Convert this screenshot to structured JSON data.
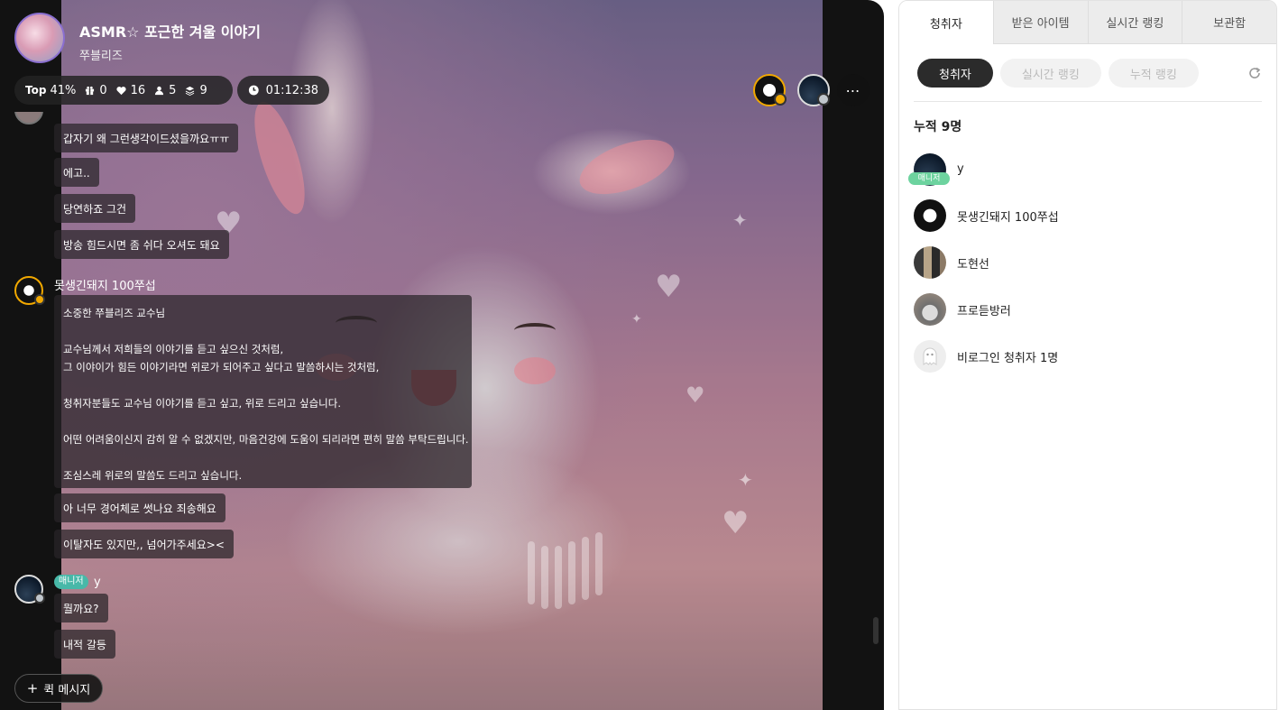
{
  "broadcast": {
    "title": "ASMR☆ 포근한 겨울 이야기",
    "streamer": "쭈블리즈",
    "stats": {
      "top_label": "Top",
      "top_value": "41%",
      "gifts": "0",
      "likes": "16",
      "listeners": "5",
      "cumulative": "9"
    },
    "elapsed": "01:12:38"
  },
  "chat": {
    "messages_top": [
      "갑자기 왜 그런생각이드셨을까요ㅠㅠ",
      "에고..",
      "당연하죠 그건",
      "방송 힘드시면 좀 쉬다 오셔도 돼요"
    ],
    "sender2": {
      "name": "못생긴돼지 100쭈섭",
      "long_message": [
        "소중한 쭈블리즈 교수님",
        "",
        "교수님께서 저희들의 이야기를 듣고 싶으신 것처럼,",
        "그 이야이가 힘든 이야기라면 위로가 되어주고 싶다고 말씀하시는 것처럼,",
        "",
        "청취자분들도 교수님 이야기를 듣고 싶고, 위로 드리고 싶습니다.",
        "",
        "어떤 어려움이신지 감히 알 수 없겠지만, 마음건강에 도움이 되리라면 편히 말씀 부탁드립니다.",
        "",
        "조심스레 위로의 말씀도 드리고 싶습니다."
      ],
      "followups": [
        "아 너무 경어체로 썻나요 죄송해요",
        "이탈자도 있지만,, 넘어가주세요><"
      ]
    },
    "sender3": {
      "tag": "매니저",
      "name": "y",
      "messages": [
        "뭘까요?",
        "내적 갈등"
      ]
    },
    "quick_message": "퀵 메시지"
  },
  "panel": {
    "tabs": [
      "청취자",
      "받은 아이템",
      "실시간 랭킹",
      "보관함"
    ],
    "segments": [
      "청취자",
      "실시간 랭킹",
      "누적 랭킹"
    ],
    "count_label": "누적 9명",
    "listeners": [
      {
        "name": "y",
        "tag": "매니저"
      },
      {
        "name": "못생긴돼지 100쭈섭",
        "tag": ""
      },
      {
        "name": "도현선",
        "tag": ""
      },
      {
        "name": "프로듣방러",
        "tag": ""
      },
      {
        "name": "비로그인 청취자 1명",
        "tag": ""
      }
    ]
  }
}
